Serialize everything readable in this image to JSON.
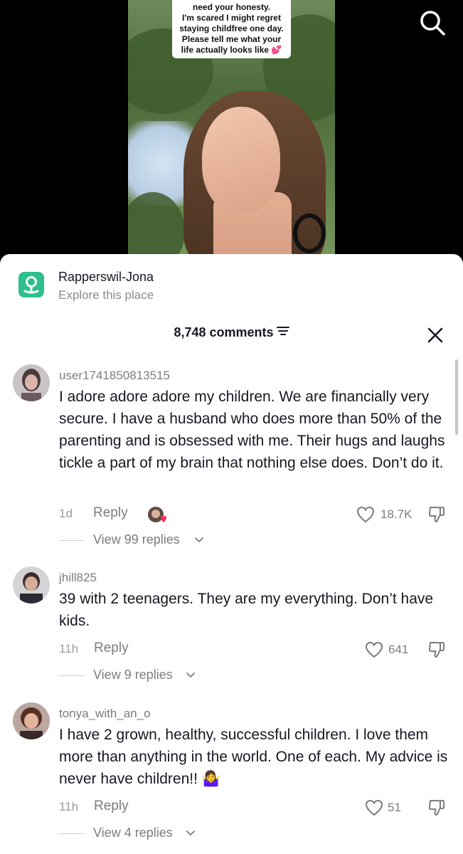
{
  "video": {
    "caption_lines": [
      "need your honesty.",
      "I'm scared I might regret",
      "staying childfree one day.",
      "Please tell me what your",
      "life actually looks like"
    ],
    "caption_emoji": "💕"
  },
  "location": {
    "name": "Rapperswil-Jona",
    "subtitle": "Explore this place",
    "icon": "map-pin-icon",
    "color": "#2ebf8f"
  },
  "comments_header": {
    "count_label": "8,748 comments"
  },
  "comments": [
    {
      "username": "user1741850813515",
      "text": "I adore adore adore my children. We are financially very secure. I have a husband who does more than 50% of the parenting and is obsessed with me. Their hugs and laughs tickle a part of my brain that nothing else does. Don’t do it.",
      "time": "1d",
      "reply_label": "Reply",
      "likes": "18.7K",
      "view_replies": "View 99 replies",
      "creator_liked": true
    },
    {
      "username": "jhill825",
      "text": "39 with 2 teenagers. They are my everything. Don’t have kids.",
      "time": "11h",
      "reply_label": "Reply",
      "likes": "641",
      "view_replies": "View 9 replies",
      "creator_liked": false
    },
    {
      "username": "tonya_with_an_o",
      "text": "I have 2 grown, healthy, successful children. I love them more than anything in the world. One of each. My advice is never have children!! 🤷‍♀️",
      "time": "11h",
      "reply_label": "Reply",
      "likes": "51",
      "view_replies": "View 4 replies",
      "creator_liked": false
    }
  ],
  "colors": {
    "text_primary": "#161823",
    "text_secondary": "#7c7c82",
    "liked_heart": "#fe2c55"
  }
}
